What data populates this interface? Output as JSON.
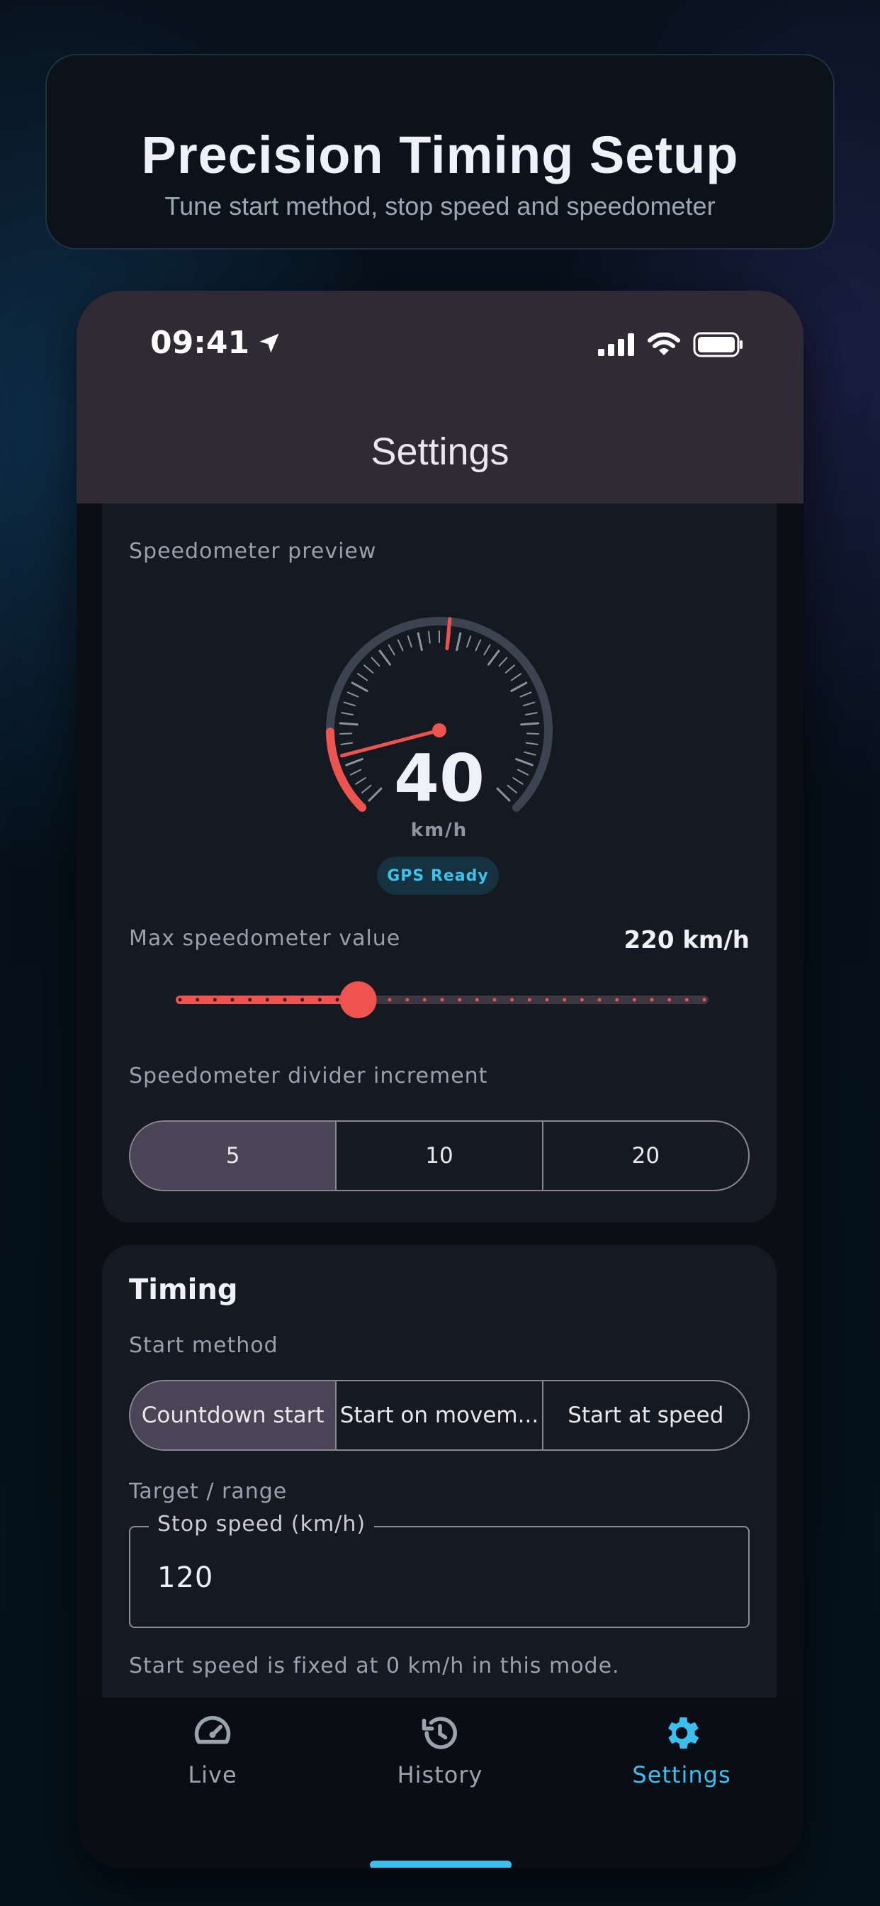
{
  "hero": {
    "title": "Precision Timing Setup",
    "subtitle": "Tune start method, stop speed and speedometer"
  },
  "status_bar": {
    "time": "09:41"
  },
  "nav": {
    "title": "Settings"
  },
  "speedometer_section": {
    "label": "Speedometer preview",
    "gauge": {
      "value": "40",
      "unit": "km/h",
      "max": 220,
      "current": 40
    },
    "gps_badge": "GPS Ready",
    "max_label": "Max speedometer value",
    "max_value": "220 km/h",
    "slider_fraction": 0.34,
    "divider_label": "Speedometer divider increment",
    "divider_options": [
      "5",
      "10",
      "20"
    ],
    "divider_selected": "5"
  },
  "timing": {
    "title": "Timing",
    "start_method_label": "Start method",
    "start_methods": [
      "Countdown start",
      "Start on movem...",
      "Start at speed"
    ],
    "start_method_selected": "Countdown start",
    "target_label": "Target / range",
    "stop_speed_field": {
      "label": "Stop speed (km/h)",
      "value": "120"
    },
    "helper": "Start speed is fixed at 0 km/h in this mode."
  },
  "tabbar": {
    "tabs": [
      {
        "label": "Live",
        "icon": "speedometer-icon"
      },
      {
        "label": "History",
        "icon": "history-icon"
      },
      {
        "label": "Settings",
        "icon": "gear-icon"
      }
    ],
    "active": "Settings"
  },
  "colors": {
    "accent": "#39bff0",
    "needle": "#ef5350",
    "selected_segment": "#4a4457"
  }
}
